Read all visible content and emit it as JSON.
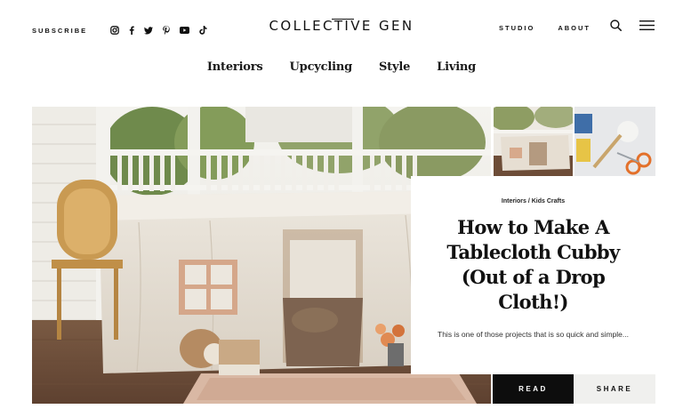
{
  "header": {
    "subscribe_label": "SUBSCRIBE",
    "social_icons": [
      "instagram-icon",
      "facebook-icon",
      "twitter-icon",
      "pinterest-icon",
      "youtube-icon",
      "tiktok-icon"
    ],
    "logo": "COLLECTIVE GEN",
    "studio_label": "STUDIO",
    "about_label": "ABOUT",
    "icons": [
      "search-icon",
      "menu-icon"
    ]
  },
  "categories": [
    "Interiors",
    "Upcycling",
    "Style",
    "Living"
  ],
  "feature": {
    "category": "Interiors",
    "separator": " / ",
    "subcategory": "Kids Crafts",
    "title": "How to Make A Tablecloth Cubby (Out of a Drop Cloth!)",
    "excerpt": "This is one of those projects that is so quick and simple...",
    "read_label": "READ",
    "share_label": "SHARE"
  },
  "colors": {
    "text": "#111111",
    "button_dark": "#0d0d0d",
    "button_light": "#f0f0ee"
  }
}
